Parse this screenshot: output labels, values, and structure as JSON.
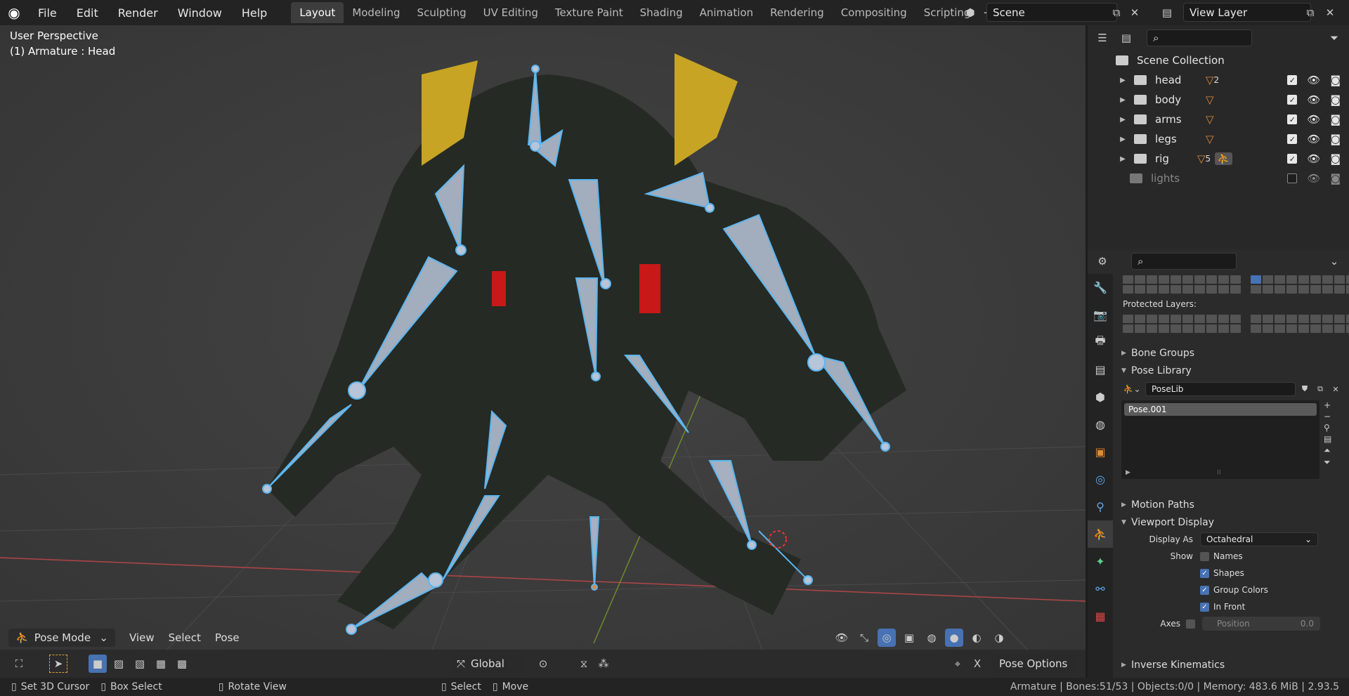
{
  "menu": [
    "File",
    "Edit",
    "Render",
    "Window",
    "Help"
  ],
  "workspaces": [
    "Layout",
    "Modeling",
    "Sculpting",
    "UV Editing",
    "Texture Paint",
    "Shading",
    "Animation",
    "Rendering",
    "Compositing",
    "Scripting"
  ],
  "scene_name": "Scene",
  "view_layer": "View Layer",
  "viewport": {
    "perspective": "User Perspective",
    "active": "(1) Armature : Head",
    "mode": "Pose Mode",
    "menus": [
      "View",
      "Select",
      "Pose"
    ],
    "orientation": "Global",
    "pose_options": "Pose Options"
  },
  "outliner": {
    "root": "Scene Collection",
    "items": [
      {
        "name": "head",
        "badge": "2"
      },
      {
        "name": "body",
        "badge": ""
      },
      {
        "name": "arms",
        "badge": ""
      },
      {
        "name": "legs",
        "badge": ""
      },
      {
        "name": "rig",
        "badge": "5"
      },
      {
        "name": "lights",
        "badge": ""
      }
    ]
  },
  "props": {
    "protected_layers": "Protected Layers:",
    "bone_groups": "Bone Groups",
    "pose_library": "Pose Library",
    "poselib": "PoseLib",
    "pose_item": "Pose.001",
    "motion_paths": "Motion Paths",
    "viewport_display": "Viewport Display",
    "display_as_label": "Display As",
    "display_as": "Octahedral",
    "show_label": "Show",
    "show_names": "Names",
    "show_shapes": "Shapes",
    "show_group_colors": "Group Colors",
    "show_in_front": "In Front",
    "axes_label": "Axes",
    "axes_position": "Position",
    "axes_value": "0.0",
    "inverse_kinematics": "Inverse Kinematics"
  },
  "status": {
    "set_cursor": "Set 3D Cursor",
    "box_select": "Box Select",
    "rotate_view": "Rotate View",
    "select": "Select",
    "move": "Move",
    "info": "Armature | Bones:51/53 | Objects:0/0 | Memory: 483.6 MiB | 2.93.5"
  },
  "colors": {
    "accent": "#4772b3",
    "bone": "#b8c4d8",
    "bone_outline": "#5bb6f0",
    "object_orange": "#e08a3a"
  }
}
